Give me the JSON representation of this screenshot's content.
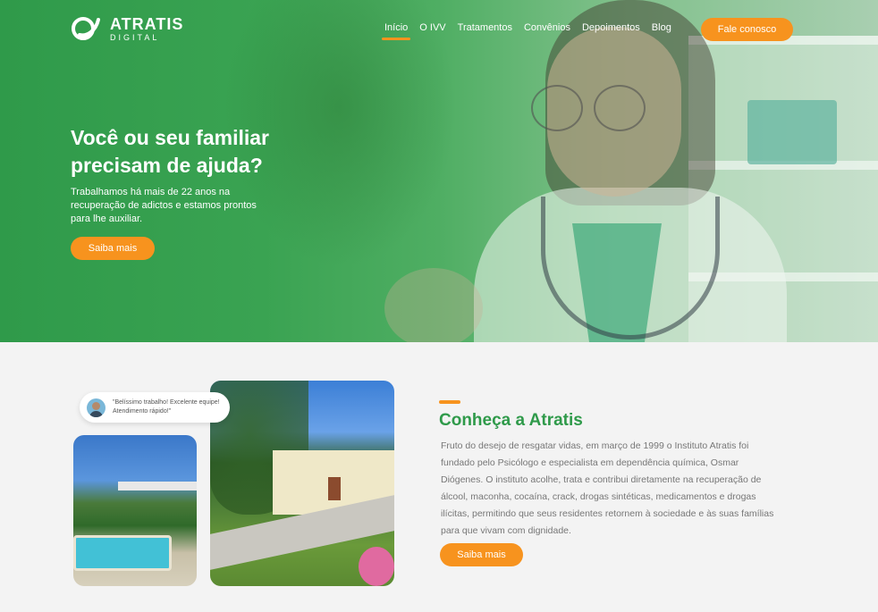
{
  "brand": {
    "name": "ATRATIS",
    "tagline": "DIGITAL",
    "accent": "#f7931e",
    "green": "#2f9a4a"
  },
  "nav": {
    "items": [
      {
        "label": "Início",
        "active": true
      },
      {
        "label": "O IVV"
      },
      {
        "label": "Tratamentos"
      },
      {
        "label": "Convênios"
      },
      {
        "label": "Depoimentos"
      },
      {
        "label": "Blog"
      }
    ],
    "contact_label": "Fale conosco"
  },
  "hero": {
    "title_line1": "Você ou seu familiar",
    "title_line2": "precisam de ajuda?",
    "subtitle": "Trabalhamos há mais de 22 anos na recuperação de adictos e estamos prontos para lhe auxiliar.",
    "cta_label": "Saiba mais"
  },
  "review": {
    "quote": "\"Belíssimo trabalho! Excelente equipe! Atendimento rápido!\""
  },
  "about": {
    "title": "Conheça a Atratis",
    "text": "Fruto do desejo de resgatar vidas, em março de 1999  o Instituto Atratis foi fundado pelo Psicólogo e especialista em dependência química, Osmar Diógenes. O instituto acolhe, trata e contribui diretamente na recuperação de álcool, maconha, cocaína, crack, drogas sintéticas, medicamentos e drogas ilícitas, permitindo que seus residentes retornem à sociedade e às suas famílias para que vivam com dignidade.",
    "cta_label": "Saiba mais"
  }
}
